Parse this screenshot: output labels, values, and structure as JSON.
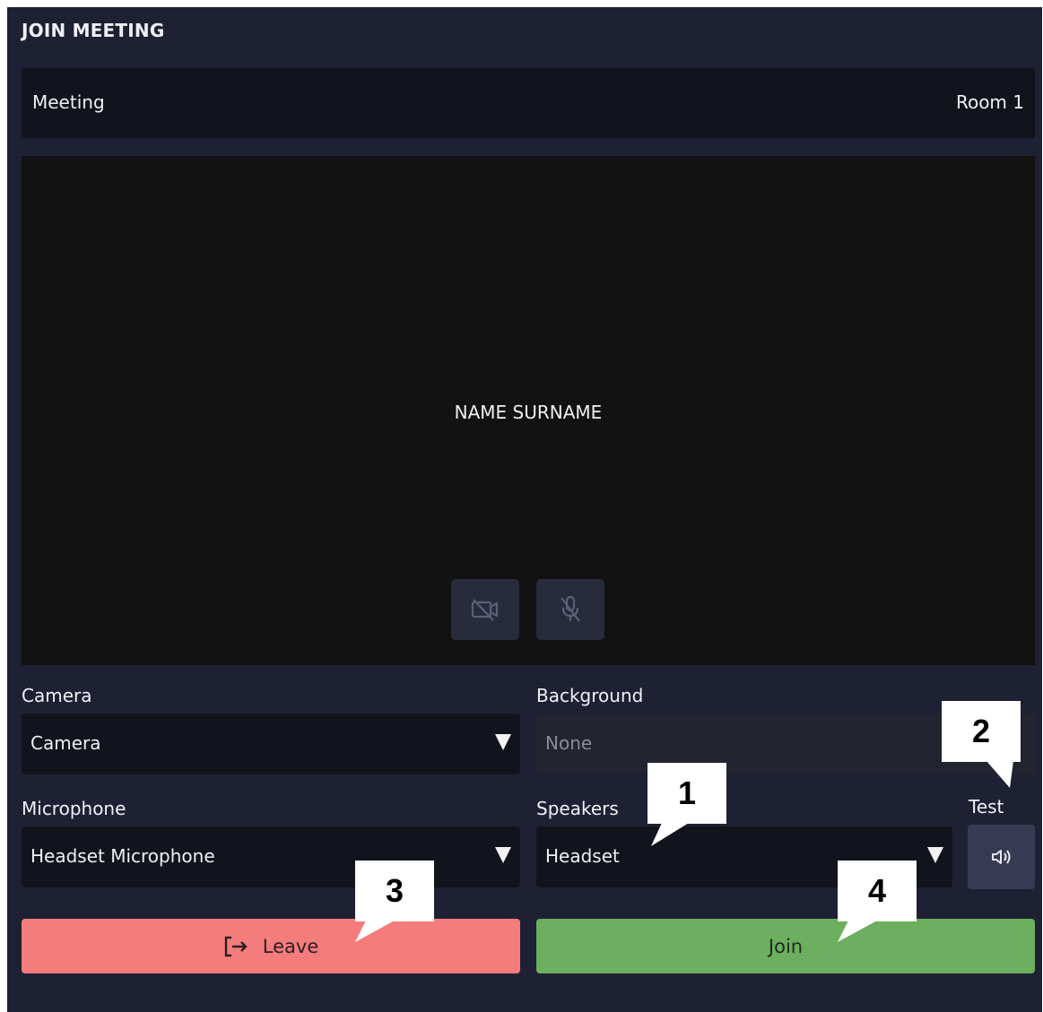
{
  "header": {
    "title": "JOIN MEETING"
  },
  "meeting": {
    "label": "Meeting",
    "value": "Room 1"
  },
  "preview": {
    "name": "NAME SURNAME"
  },
  "media_controls": {
    "camera_icon": "camera-off-icon",
    "mic_icon": "mic-off-icon"
  },
  "camera": {
    "label": "Camera",
    "value": "Camera"
  },
  "background": {
    "label": "Background",
    "value": "None"
  },
  "microphone": {
    "label": "Microphone",
    "value": "Headset Microphone"
  },
  "speakers": {
    "label": "Speakers",
    "value": "Headset"
  },
  "test": {
    "label": "Test",
    "icon": "speaker-icon"
  },
  "actions": {
    "leave_label": "Leave",
    "join_label": "Join"
  },
  "callouts": [
    "1",
    "2",
    "3",
    "4"
  ],
  "colors": {
    "panel": "#1e2133",
    "field": "#12141d",
    "leave": "#f47c7c",
    "join": "#6caf5f",
    "test": "#363a52"
  }
}
